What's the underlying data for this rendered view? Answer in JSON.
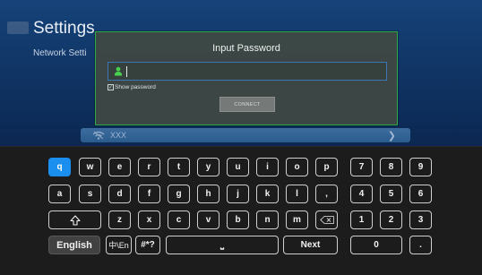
{
  "background": {
    "title": "Settings",
    "subtitle": "Network Setti",
    "network_row": {
      "ssid": "XXX"
    }
  },
  "dialog": {
    "title": "Input Password",
    "password_value": "",
    "show_password_label": "Show password",
    "show_password_checked": true,
    "connect_label": "CONNECT"
  },
  "keyboard": {
    "row1": [
      "q",
      "w",
      "e",
      "r",
      "t",
      "y",
      "u",
      "i",
      "o",
      "p"
    ],
    "row2": [
      "a",
      "s",
      "d",
      "f",
      "g",
      "h",
      "j",
      "k",
      "l",
      ","
    ],
    "row3": [
      "z",
      "x",
      "c",
      "v",
      "b",
      "n",
      "m"
    ],
    "lang_label": "English",
    "toggle_label": "中\\En",
    "symbols_label": "#*?",
    "space_symbol": "⎵",
    "next_label": "Next",
    "numpad": [
      "7",
      "8",
      "9",
      "4",
      "5",
      "6",
      "1",
      "2",
      "3",
      "0",
      "."
    ],
    "selected_key": "q"
  },
  "colors": {
    "accent": "#1b8ff0",
    "dialog_border": "#2eaa48",
    "field_border": "#3d76b6"
  },
  "icons": {
    "shift": "shift-icon",
    "backspace": "backspace-icon",
    "user": "user-icon",
    "wifi": "wifi-icon"
  }
}
